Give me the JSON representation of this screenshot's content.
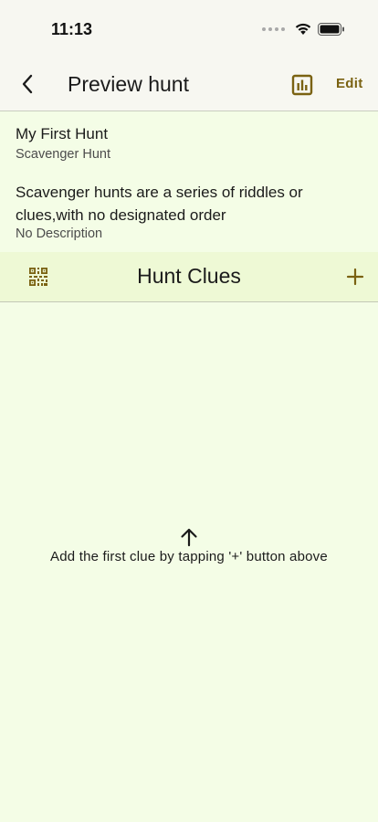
{
  "status_bar": {
    "time": "11:13",
    "icons": [
      "signal-dots-icon",
      "wifi-icon",
      "battery-icon"
    ]
  },
  "app_bar": {
    "title": "Preview hunt",
    "back_icon": "chevron-left-icon",
    "stats_icon": "bar-chart-icon",
    "edit_label": "Edit"
  },
  "hunt": {
    "name": "My First Hunt",
    "type": "Scavenger Hunt",
    "type_description": "Scavenger hunts are a series of riddles or clues,with no designated order",
    "description": "No Description"
  },
  "clues": {
    "title": "Hunt Clues",
    "qr_icon": "qr-code-icon",
    "add_icon": "plus-icon",
    "empty_message": "Add the first clue by tapping '+' button above"
  },
  "colors": {
    "accent": "#7a6212",
    "background": "#f4fde6",
    "header_bar": "#f7f7f1",
    "clues_header": "#eef9d5"
  }
}
